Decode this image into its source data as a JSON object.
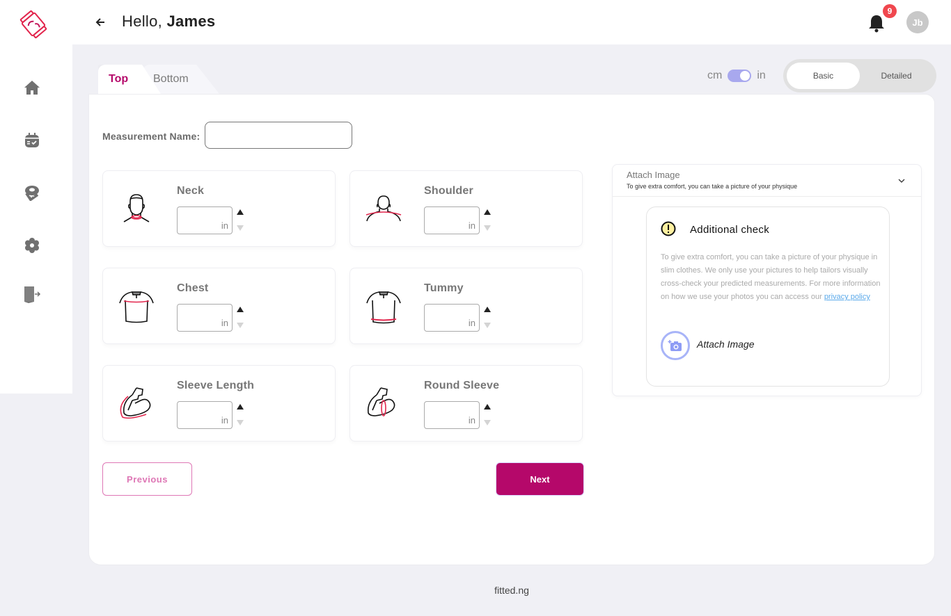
{
  "app": {
    "brand_color": "#b5086a",
    "footer": "fitted.ng"
  },
  "sidebar": {
    "logo": "fitted-logo",
    "items": [
      {
        "name": "home",
        "icon": "home-icon"
      },
      {
        "name": "schedule",
        "icon": "calendar-check-icon"
      },
      {
        "name": "measurements",
        "icon": "tape-measure-icon"
      },
      {
        "name": "settings",
        "icon": "gear-icon"
      },
      {
        "name": "logout",
        "icon": "logout-door-icon"
      }
    ]
  },
  "header": {
    "greeting": "Hello,",
    "user_name": "James",
    "notification_count": "9",
    "avatar_initials": "Jb"
  },
  "tabs": [
    {
      "label": "Top",
      "active": true
    },
    {
      "label": "Bottom",
      "active": false
    }
  ],
  "units": {
    "left": "cm",
    "right": "in",
    "selected": "in"
  },
  "mode": {
    "options": [
      "Basic",
      "Detailed"
    ],
    "selected": "Basic"
  },
  "form": {
    "measurement_name_label": "Measurement Name:",
    "measurement_name_value": "",
    "fields": [
      {
        "label": "Neck",
        "value": "",
        "unit": "in",
        "icon": "neck-icon"
      },
      {
        "label": "Shoulder",
        "value": "",
        "unit": "in",
        "icon": "shoulder-icon"
      },
      {
        "label": "Chest",
        "value": "",
        "unit": "in",
        "icon": "chest-icon"
      },
      {
        "label": "Tummy",
        "value": "",
        "unit": "in",
        "icon": "tummy-icon"
      },
      {
        "label": "Sleeve Length",
        "value": "",
        "unit": "in",
        "icon": "sleeve-length-icon"
      },
      {
        "label": "Round Sleeve",
        "value": "",
        "unit": "in",
        "icon": "round-sleeve-icon"
      }
    ],
    "previous_label": "Previous",
    "next_label": "Next"
  },
  "attach": {
    "title": "Attach Image",
    "subtitle": "To give extra comfort, you can take a picture of your physique",
    "check_title": "Additional check",
    "check_body": "To give extra comfort, you can take a picture of your physique in slim clothes. We only use your pictures to help tailors visually cross-check your predicted measurements. For more information on how we use your photos you can access our",
    "privacy_link": "privacy policy",
    "button_label": "Attach Image"
  }
}
